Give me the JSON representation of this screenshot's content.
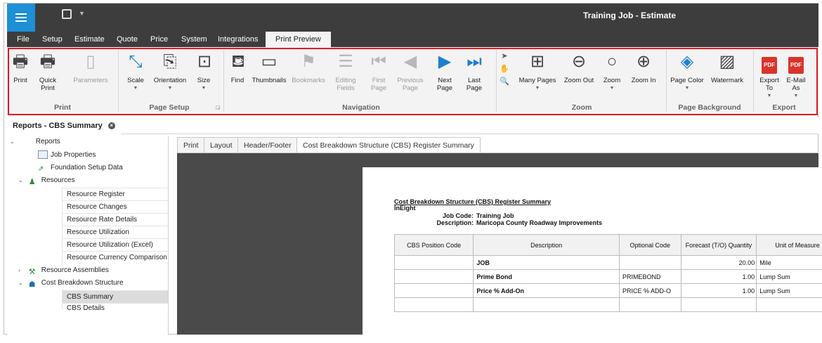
{
  "window": {
    "title": "Training Job - Estimate"
  },
  "menu": [
    "File",
    "Setup",
    "Estimate",
    "Quote",
    "Price",
    "System",
    "Integrations",
    "Print Preview"
  ],
  "ribbon": {
    "groups": {
      "print": "Print",
      "page_setup": "Page Setup",
      "navigation": "Navigation",
      "zoom": "Zoom",
      "page_background": "Page Background",
      "export": "Export"
    },
    "buttons": {
      "print": "Print",
      "quick_print": "Quick Print",
      "parameters": "Parameters",
      "scale": "Scale",
      "orientation": "Orientation",
      "size": "Size",
      "find": "Find",
      "thumbnails": "Thumbnails",
      "bookmarks": "Bookmarks",
      "editing_fields": "Editing Fields",
      "first_page": "First Page",
      "previous_page": "Previous Page",
      "next_page": "Next Page",
      "last_page": "Last Page",
      "many_pages": "Many Pages",
      "zoom_out": "Zoom Out",
      "zoom": "Zoom",
      "zoom_in": "Zoom In",
      "page_color": "Page Color",
      "watermark": "Watermark",
      "export_to": "Export To",
      "email_as": "E-Mail As"
    },
    "pdf_label": "PDF"
  },
  "doc_tab": {
    "label": "Reports - CBS Summary"
  },
  "tree": [
    {
      "label": "Reports"
    },
    {
      "label": "Job Properties"
    },
    {
      "label": "Foundation Setup Data"
    },
    {
      "label": "Resources"
    },
    {
      "label": "Resource Register"
    },
    {
      "label": "Resource Changes"
    },
    {
      "label": "Resource Rate Details"
    },
    {
      "label": "Resource Utilization"
    },
    {
      "label": "Resource Utilization (Excel)"
    },
    {
      "label": "Resource Currency Comparison"
    },
    {
      "label": "Resource Assemblies"
    },
    {
      "label": "Cost Breakdown Structure"
    },
    {
      "label": "CBS Summary"
    },
    {
      "label": "CBS Details"
    }
  ],
  "preview_tabs": [
    "Print",
    "Layout",
    "Header/Footer",
    "Cost Breakdown Structure (CBS) Register Summary"
  ],
  "report": {
    "title": "Cost Breakdown Structure (CBS) Register Summary",
    "company": "InEight",
    "job_code_label": "Job Code:",
    "job_code": "Training Job",
    "description_label": "Description:",
    "description": "Maricopa County Roadway Improvements",
    "columns": [
      "CBS Position Code",
      "Description",
      "Optional Code",
      "Forecast (T/O) Quantity",
      "Unit of Measure"
    ],
    "rows": [
      {
        "code": "",
        "description": "JOB",
        "optional": "",
        "qty": "20.00",
        "unit": "Mile"
      },
      {
        "code": "",
        "description": "Prime Bond",
        "optional": "PRIMEBOND",
        "qty": "1.00",
        "unit": "Lump Sum"
      },
      {
        "code": "",
        "description": "Price % Add-On",
        "optional": "PRICE % ADD-O",
        "qty": "1.00",
        "unit": "Lump Sum"
      }
    ]
  }
}
